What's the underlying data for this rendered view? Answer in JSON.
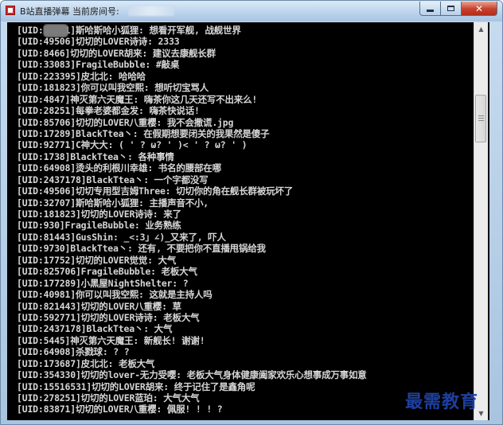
{
  "window": {
    "title": "B站直播弹幕 当前房间号:"
  },
  "controls": {
    "minimize_icon": "minimize-icon",
    "maximize_icon": "maximize-icon",
    "close_icon": "close-icon",
    "close_glyph": "✕"
  },
  "lines": [
    {
      "uid": "[UID:9",
      "text": "2771]斯哈斯哈小狐狸: 想看开军舰, 战舰世界"
    },
    {
      "uid": "[UID:4",
      "text": "9506]切切的LOVER诗诗: 2333"
    },
    {
      "uid": "[UID:8",
      "text": "466]切切的LOVER胡来: 建议去康舰长群"
    },
    {
      "uid": "[UID:3",
      "text": "3083]FragileBubble: #敲桌"
    },
    {
      "uid": "[UID:2",
      "text": "23395]皮北北: 哈哈哈"
    },
    {
      "uid": "[UID:1",
      "text": "81823]你可以叫我空熙: 想听切宝骂人"
    },
    {
      "uid": "[UID:4",
      "text": "847]神灭第六天魔王: 嗨茶你这几天还写不出来么!"
    },
    {
      "uid": "[UID:2",
      "text": "8251]每拳老婆都金发: 嗨茶快说话!"
    },
    {
      "uid": "[UID:8",
      "text": "5706]切切的LOVER八重樱: 我不会撒谎.jpg"
    },
    {
      "uid": "[UID:1",
      "text": "7289]BlackTtea丶: 在假期想要闭关的我果然是傻子"
    },
    {
      "uid": "[UID:9",
      "text": "2771]C神大大: ( ' ? ω? ' )< ' ? ω? ' )"
    },
    {
      "uid": "[UID:1",
      "text": "738]BlackTtea丶: 各种事情"
    },
    {
      "uid": "[UID:6",
      "text": "4908]烫头的利根川幸雄: 书名的腰部在哪"
    },
    {
      "uid": "[UID:2",
      "text": "437178]BlackTtea丶: 一个字都没写"
    },
    {
      "uid": "[UID:4",
      "text": "9506]切切专用型吉姆Three: 切切你的角在舰长群被玩坏了"
    },
    {
      "uid": "[UID:3",
      "text": "2707]斯哈斯哈小狐狸: 主播声音不小,"
    },
    {
      "uid": "[UID:1",
      "text": "81823]切切的LOVER诗诗: 来了"
    },
    {
      "uid": "[UID:9",
      "text": "30]FragileBubble: 业务熟练"
    },
    {
      "uid": "[UID:8",
      "text": "1443]GusShin: _<:3」∠)_又来了, 吓人"
    },
    {
      "uid": "[UID:9",
      "text": "730]BlackTtea丶: 还有, 不要把你不直播甩锅给我"
    },
    {
      "uid": "[UID:1",
      "text": "7752]切切的LOVER觉觉: 大气"
    },
    {
      "uid": "[UID:8",
      "text": "25706]FragileBubble: 老板大气"
    },
    {
      "uid": "[UID:1",
      "text": "77289]小黑屋NightShelter: ?"
    },
    {
      "uid": "[UID:4",
      "text": "0981]你可以叫我空熙: 这就是主持人吗"
    },
    {
      "uid": "[UID:8",
      "text": "21443]切切的LOVER八重樱: 草"
    },
    {
      "uid": "[UID:5",
      "text": "92771]切切的LOVER诗诗: 老板大气"
    },
    {
      "uid": "[UID:2",
      "text": "437178]BlackTtea丶: 大气"
    },
    {
      "uid": "[UID:5",
      "text": "445]神灭第六天魔王: 新舰长! 谢谢!"
    },
    {
      "uid": "[UID:6",
      "text": "4908]杀戮球: ? ?"
    },
    {
      "uid": "[UID:1",
      "text": "73687]皮北北: 老板大气"
    },
    {
      "uid": "[UID:3",
      "text": "54330]切切的lover-无力受嘤: 老板大气身体健康阖家欢乐心想事成万事如意"
    },
    {
      "uid": "[UID:1",
      "text": "5516531]切切的LOVER胡来: 终于记住了是鑫角呢"
    },
    {
      "uid": "[UID:2",
      "text": "78251]切切的LOVER蓝珀: 大气大气"
    },
    {
      "uid": "[UID:8",
      "text": "3871]切切的LOVER八重樱: 佩服! ! ! ?"
    }
  ],
  "scrollbar": {
    "up_icon": "scroll-up-arrow-icon",
    "down_icon": "scroll-down-arrow-icon",
    "up_glyph": "▲",
    "down_glyph": "▼"
  },
  "watermark": {
    "text": "最需教育"
  },
  "colors": {
    "console_bg": "#000000",
    "console_text": "#d6d6d6",
    "watermark": "#1e3f9e",
    "close_button": "#c7402a"
  }
}
